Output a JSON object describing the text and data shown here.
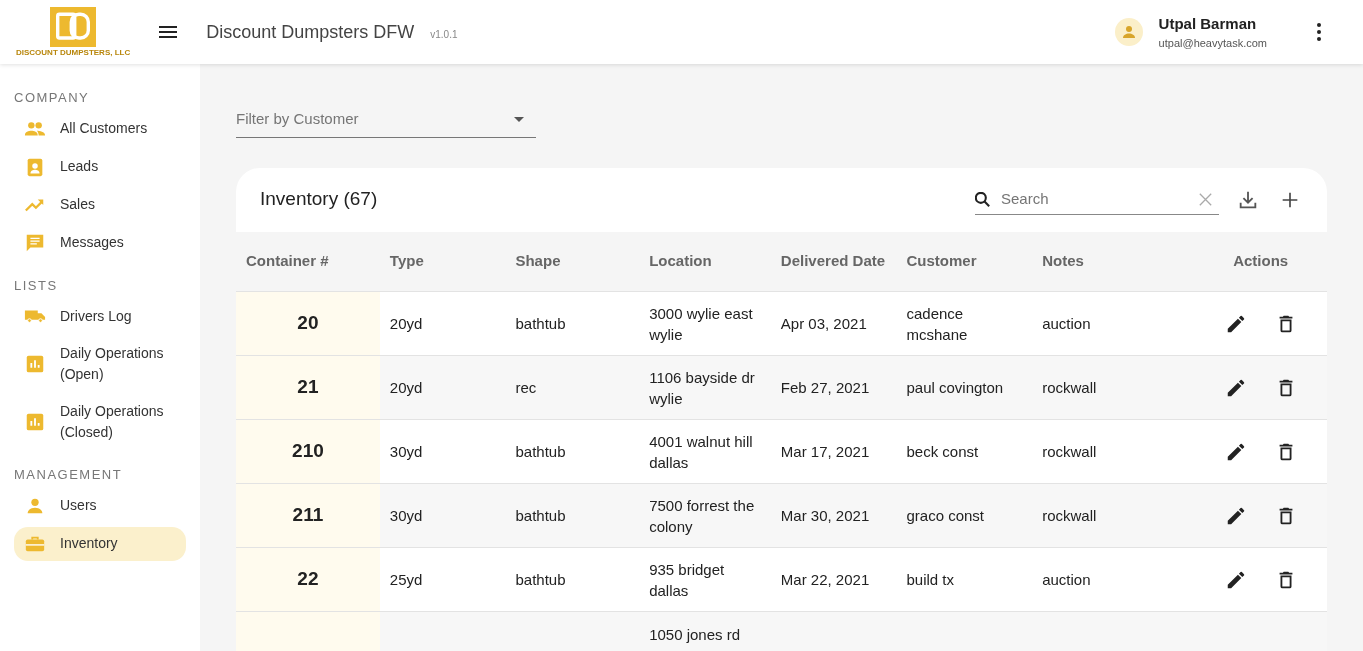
{
  "header": {
    "logo_caption": "DISCOUNT DUMPSTERS, LLC",
    "title": "Discount Dumpsters DFW",
    "version": "v1.0.1",
    "user_name": "Utpal Barman",
    "user_email": "utpal@heavytask.com"
  },
  "sidebar": [
    {
      "heading": "COMPANY",
      "items": [
        {
          "label": "All Customers",
          "selected": false
        },
        {
          "label": "Leads",
          "selected": false
        },
        {
          "label": "Sales",
          "selected": false
        },
        {
          "label": "Messages",
          "selected": false
        }
      ]
    },
    {
      "heading": "LISTS",
      "items": [
        {
          "label": "Drivers Log",
          "selected": false
        },
        {
          "label": "Daily Operations (Open)",
          "selected": false
        },
        {
          "label": "Daily Operations (Closed)",
          "selected": false
        }
      ]
    },
    {
      "heading": "MANAGEMENT",
      "items": [
        {
          "label": "Users",
          "selected": false
        },
        {
          "label": "Inventory",
          "selected": true
        }
      ]
    }
  ],
  "filter": {
    "placeholder": "Filter by Customer"
  },
  "table": {
    "title": "Inventory (67)",
    "search_placeholder": "Search",
    "columns": [
      "Container #",
      "Type",
      "Shape",
      "Location",
      "Delivered Date",
      "Customer",
      "Notes",
      "Actions"
    ],
    "rows": [
      {
        "container": "20",
        "type": "20yd",
        "shape": "bathtub",
        "location": "3000 wylie east wylie",
        "delivered": "Apr 03, 2021",
        "customer": "cadence mcshane",
        "notes": "auction"
      },
      {
        "container": "21",
        "type": "20yd",
        "shape": "rec",
        "location": "1106 bayside dr wylie",
        "delivered": "Feb 27, 2021",
        "customer": "paul covington",
        "notes": "rockwall"
      },
      {
        "container": "210",
        "type": "30yd",
        "shape": "bathtub",
        "location": "4001 walnut hill dallas",
        "delivered": "Mar 17, 2021",
        "customer": "beck const",
        "notes": "rockwall"
      },
      {
        "container": "211",
        "type": "30yd",
        "shape": "bathtub",
        "location": "7500 forrest the colony",
        "delivered": "Mar 30, 2021",
        "customer": "graco const",
        "notes": "rockwall"
      },
      {
        "container": "22",
        "type": "25yd",
        "shape": "bathtub",
        "location": "935 bridget dallas",
        "delivered": "Mar 22, 2021",
        "customer": "build tx",
        "notes": "auction"
      },
      {
        "location": "1050 jones rd"
      }
    ]
  }
}
